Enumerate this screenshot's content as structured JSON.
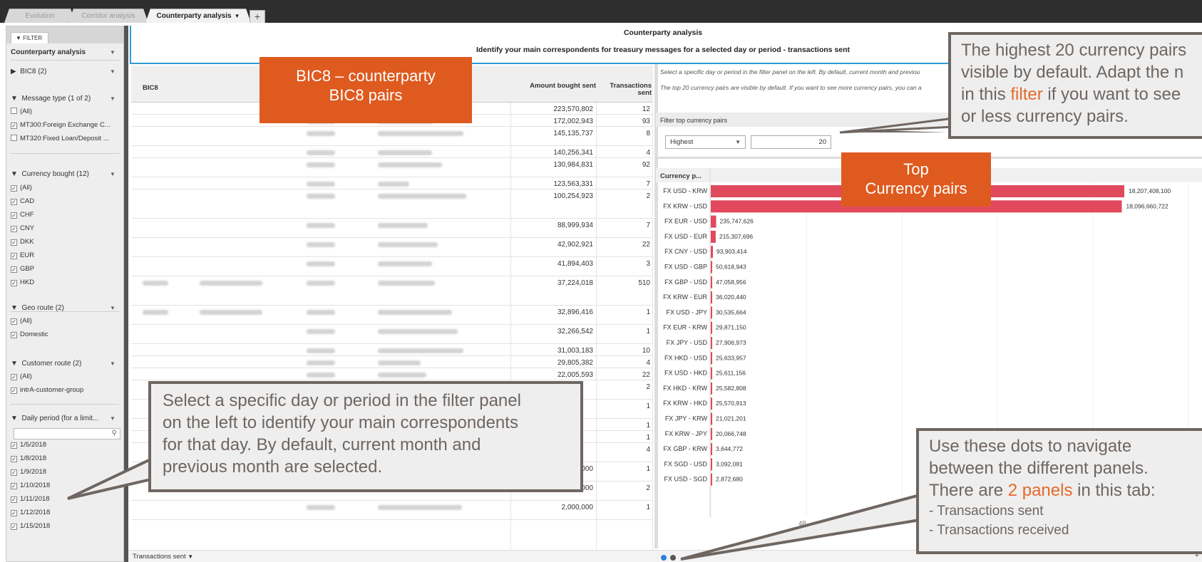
{
  "tabs": [
    {
      "label": "Evolution"
    },
    {
      "label": "Corridor analysis"
    },
    {
      "label": "Counterparty analysis"
    }
  ],
  "filter": {
    "tab_label": "FILTER",
    "view_label": "Counterparty analysis",
    "bic8_title": "BIC8 (2)",
    "message_type": {
      "title": "Message type (1 of 2)",
      "items": [
        {
          "label": "(All)",
          "checked": false
        },
        {
          "label": "MT300:Foreign Exchange C...",
          "checked": true
        },
        {
          "label": "MT320:Fixed Loan/Deposit ...",
          "checked": false
        }
      ]
    },
    "currency_bought": {
      "title": "Currency bought (12)",
      "items": [
        "(All)",
        "CAD",
        "CHF",
        "CNY",
        "DKK",
        "EUR",
        "GBP",
        "HKD"
      ]
    },
    "geo_route": {
      "title": "Geo route (2)",
      "items": [
        "(All)",
        "Domestic"
      ]
    },
    "customer_route": {
      "title": "Customer route (2)",
      "items": [
        "(All)",
        "intrA-customer-group"
      ]
    },
    "daily_period": {
      "title": "Daily period (for a limit...",
      "items": [
        "1/5/2018",
        "1/8/2018",
        "1/9/2018",
        "1/10/2018",
        "1/11/2018",
        "1/12/2018",
        "1/15/2018"
      ]
    }
  },
  "header": {
    "title": "Counterparty analysis",
    "subtitle": "Identify your main correspondents for treasury messages for a selected day or period - transactions sent"
  },
  "table": {
    "col_bic8": "BIC8",
    "col_amount": "Amount bought sent",
    "col_transactions": "Transactions sent",
    "rows": [
      {
        "amount": "223,570,802",
        "count": "12"
      },
      {
        "amount": "172,002,943",
        "count": "93"
      },
      {
        "amount": "145,135,737",
        "count": "8"
      },
      {
        "amount": "140,256,341",
        "count": "4"
      },
      {
        "amount": "130,984,831",
        "count": "92"
      },
      {
        "amount": "123,563,331",
        "count": "7"
      },
      {
        "amount": "100,254,923",
        "count": "2"
      },
      {
        "amount": "88,999,934",
        "count": "7"
      },
      {
        "amount": "42,902,921",
        "count": "22"
      },
      {
        "amount": "41,894,403",
        "count": "3"
      },
      {
        "amount": "37,224,018",
        "count": "510"
      },
      {
        "amount": "32,896,416",
        "count": "1"
      },
      {
        "amount": "32,266,542",
        "count": "1"
      },
      {
        "amount": "31,003,183",
        "count": "10"
      },
      {
        "amount": "29,805,382",
        "count": "4"
      },
      {
        "amount": "22,005,593",
        "count": "22"
      },
      {
        "amount": "",
        "count": "2"
      },
      {
        "amount": "",
        "count": "1"
      },
      {
        "amount": "",
        "count": "1"
      },
      {
        "amount": "",
        "count": "1"
      },
      {
        "amount": "",
        "count": "4"
      },
      {
        "amount": "2,000,000",
        "count": "1"
      },
      {
        "amount": "2,000,000",
        "count": "2"
      },
      {
        "amount": "2,000,000",
        "count": "1"
      }
    ]
  },
  "right": {
    "info1": "Select a specific day or period in the filter panel on the left. By default, current month and previou",
    "info2": "The top 20 currency pairs are visible by default. If you want to see more currency pairs, you can a",
    "filter_label": "Filter top currency pairs",
    "select_value": "Highest",
    "input_value": "20"
  },
  "chart_data": {
    "type": "bar",
    "orientation": "horizontal",
    "column_header": "Currency p...",
    "axis_tick": "4B",
    "bar_color": "#e04a5c",
    "categories": [
      "FX USD - KRW",
      "FX KRW - USD",
      "FX EUR - USD",
      "FX USD - EUR",
      "FX CNY - USD",
      "FX USD - GBP",
      "FX GBP - USD",
      "FX KRW - EUR",
      "FX USD - JPY",
      "FX EUR - KRW",
      "FX JPY - USD",
      "FX HKD - USD",
      "FX USD - HKD",
      "FX HKD - KRW",
      "FX KRW - HKD",
      "FX JPY - KRW",
      "FX KRW - JPY",
      "FX GBP - KRW",
      "FX SGD - USD",
      "FX USD - SGD"
    ],
    "values": [
      18207408100,
      18096660722,
      235747626,
      215307696,
      93903414,
      50618943,
      47058956,
      36020440,
      30535664,
      29871150,
      27906973,
      25633957,
      25611156,
      25582808,
      25570913,
      21021201,
      20066748,
      3644772,
      3092081,
      2872680
    ],
    "labels": [
      "18,207,408,100",
      "18,096,660,722",
      "235,747,626",
      "215,307,696",
      "93,903,414",
      "50,618,943",
      "47,058,956",
      "36,020,440",
      "30,535,664",
      "29,871,150",
      "27,906,973",
      "25,633,957",
      "25,611,156",
      "25,582,808",
      "25,570,913",
      "21,021,201",
      "20,066,748",
      "3,644,772",
      "3,092,081",
      "2,872,680"
    ]
  },
  "bottom": {
    "panel_label": "Transactions sent"
  },
  "callouts": {
    "bic8_line1": "BIC8 – counterparty",
    "bic8_line2": "BIC8 pairs",
    "top_line1": "Top",
    "top_line2": "Currency pairs",
    "highest_line1": "The highest 20 currency pairs",
    "highest_line2": "visible by default. Adapt the n",
    "highest_line3_pre": "in this ",
    "highest_line3_accent": "filter",
    "highest_line3_post": " if you want to see",
    "highest_line4": "or less currency pairs.",
    "period_line1": "Select a specific day or period in the filter panel",
    "period_line2": "on the left to identify your main correspondents",
    "period_line3": "for that day. By default, current month and",
    "period_line4": "previous month are selected.",
    "dots_line1": "Use these dots to navigate",
    "dots_line2": "between the different panels.",
    "dots_line3_pre": "There are ",
    "dots_line3_accent": "2 panels",
    "dots_line3_post": " in this tab:",
    "dots_bullet1": "-    Transactions sent",
    "dots_bullet2": "-    Transactions received"
  }
}
